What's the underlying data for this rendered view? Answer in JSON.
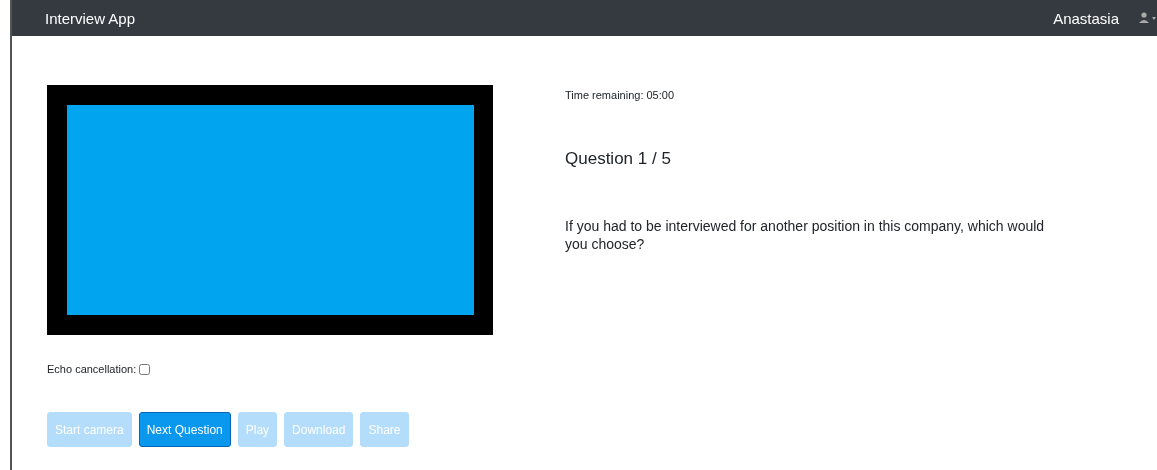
{
  "navbar": {
    "brand": "Interview App",
    "user": "Anastasia"
  },
  "timer": "Time remaining: 05:00",
  "question_title": "Question 1 / 5",
  "question_text": "If you had to be interviewed for another position in this company, which would you choose?",
  "echo_cancellation": {
    "label": "Echo cancellation:",
    "checked": false
  },
  "buttons": [
    {
      "label": "Start camera",
      "disabled": true
    },
    {
      "label": "Next Question",
      "disabled": false
    },
    {
      "label": "Play",
      "disabled": true
    },
    {
      "label": "Download",
      "disabled": true
    },
    {
      "label": "Share",
      "disabled": true
    }
  ]
}
